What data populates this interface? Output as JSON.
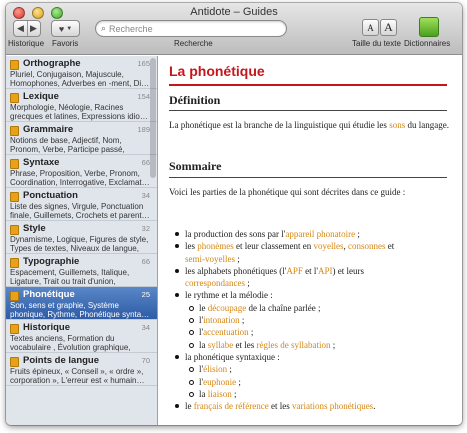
{
  "window": {
    "title": "Antidote – Guides"
  },
  "toolbar": {
    "historique": "Historique",
    "favoris": "Favoris",
    "recherche": "Recherche",
    "search_placeholder": "Recherche",
    "taille_texte": "Taille du texte",
    "dictionnaires": "Dictionnaires",
    "text_small": "A",
    "text_large": "A"
  },
  "sidebar": {
    "items": [
      {
        "title": "Orthographe",
        "count": "165",
        "desc": "Pluriel, Conjugaison, Majuscule,\nHomophones, Adverbes en -ment, Di…"
      },
      {
        "title": "Lexique",
        "count": "154",
        "desc": "Morphologie, Néologie, Racines\ngrecques et latines, Expressions idio…"
      },
      {
        "title": "Grammaire",
        "count": "189",
        "desc": "Notions de base, Adjectif, Nom,\nPronom, Verbe, Participe passé, Nom…"
      },
      {
        "title": "Syntaxe",
        "count": "66",
        "desc": "Phrase, Proposition, Verbe, Pronom,\nCoordination, Interrogative, Exclamat…"
      },
      {
        "title": "Ponctuation",
        "count": "34",
        "desc": "Liste des signes, Virgule, Ponctuation\nfinale, Guillemets, Crochets et parent…"
      },
      {
        "title": "Style",
        "count": "32",
        "desc": "Dynamisme, Logique, Figures de style,\nTypes de textes, Niveaux de langue, Régio…"
      },
      {
        "title": "Typographie",
        "count": "66",
        "desc": "Espacement, Guillemets, Italique,\nLigature, Trait ou trait d'union, Énumé…"
      },
      {
        "title": "Phonétique",
        "count": "25",
        "desc": "Son, sens et graphie, Système\nphonique, Rythme, Phonétique synta…"
      },
      {
        "title": "Historique",
        "count": "34",
        "desc": "Textes anciens, Formation du\nvocabulaire , Évolution graphique, His…"
      },
      {
        "title": "Points de langue",
        "count": "70",
        "desc": "Fruits épineux, « Conseil », « ordre »,\ncorporation », L'erreur est « humain…"
      }
    ]
  },
  "content": {
    "title": "La phonétique",
    "definition_heading": "Définition",
    "definition_pre": "La phonétique est la branche de la linguistique qui étudie les ",
    "definition_link": "sons",
    "definition_post": " du langage.",
    "sommaire_heading": "Sommaire",
    "sommaire_intro": "Voici les parties de la phonétique qui sont décrites dans ce guide :",
    "bullets": {
      "b1_pre": "la production des sons par l'",
      "b1_link": "appareil phonatoire",
      "b1_post": " ;",
      "b2_pre": "les ",
      "b2_link1": "phonèmes",
      "b2_mid1": " et leur classement en ",
      "b2_link2": "voyelles",
      "b2_mid2": ", ",
      "b2_link3": "consonnes",
      "b2_mid3": " et",
      "b2_link4": "semi-voyelles",
      "b2_post": " ;",
      "b3_pre": "les alphabets phonétiques (l'",
      "b3_link1": "APF",
      "b3_mid": " et l'",
      "b3_link2": "API",
      "b3_post1": ") et leurs",
      "b3_link3": "correspondances",
      "b3_post2": " ;",
      "b4": "le rythme et la mélodie :",
      "b4a_pre": "le ",
      "b4a_link": "découpage",
      "b4a_post": " de la chaîne parlée ;",
      "b4b_pre": "l'",
      "b4b_link": "intonation",
      "b4b_post": " ;",
      "b4c_pre": "l'",
      "b4c_link": "accentuation",
      "b4c_post": " ;",
      "b4d_pre": "la ",
      "b4d_link1": "syllabe",
      "b4d_mid": " et les ",
      "b4d_link2": "règles de syllabation",
      "b4d_post": " ;",
      "b5": "la phonétique syntaxique :",
      "b5a_pre": "l'",
      "b5a_link": "élision",
      "b5a_post": " ;",
      "b5b_pre": "l'",
      "b5b_link": "euphonie",
      "b5b_post": " ;",
      "b5c_pre": "la ",
      "b5c_link": "liaison",
      "b5c_post": " ;",
      "b6_pre": "le ",
      "b6_link1": "français de référence",
      "b6_mid": " et les ",
      "b6_link2": "variations phonétiques",
      "b6_post": "."
    }
  },
  "colors": {
    "link": "#d68714",
    "title": "#c5161c",
    "selection": "#2d5ba5"
  }
}
